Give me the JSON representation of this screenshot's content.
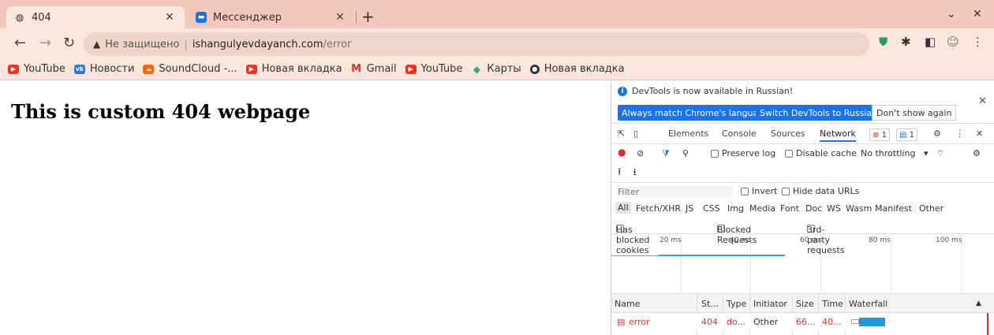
{
  "browser": {
    "tabs": [
      {
        "title": "404",
        "icon": "globe-icon",
        "active": true
      },
      {
        "title": "Мессенджер",
        "icon": "chat-icon",
        "active": false
      }
    ],
    "address": {
      "insecure_label": "Не защищено",
      "host": "ishangulyevdayanch.com",
      "path": "/error"
    },
    "bookmarks": [
      {
        "label": "YouTube",
        "icon": "youtube-icon"
      },
      {
        "label": "Новости",
        "icon": "vk-icon"
      },
      {
        "label": "SoundCloud -...",
        "icon": "soundcloud-icon"
      },
      {
        "label": "Новая вкладка",
        "icon": "youtube-icon"
      },
      {
        "label": "Gmail",
        "icon": "gmail-icon"
      },
      {
        "label": "YouTube",
        "icon": "youtube-icon"
      },
      {
        "label": "Карты",
        "icon": "maps-icon"
      },
      {
        "label": "Новая вкладка",
        "icon": "github-icon"
      }
    ]
  },
  "page": {
    "heading": "This is custom 404 webpage"
  },
  "devtools": {
    "info_message": "DevTools is now available in Russian!",
    "btn_match": "Always match Chrome's language",
    "btn_switch": "Switch DevTools to Russian",
    "btn_dismiss": "Don't show again",
    "tabs": [
      "Elements",
      "Console",
      "Sources",
      "Network"
    ],
    "error_count": "1",
    "message_count": "1",
    "network_toolbar": {
      "preserve_log": "Preserve log",
      "disable_cache": "Disable cache",
      "throttling": "No throttling"
    },
    "filter_placeholder": "Filter",
    "invert": "Invert",
    "hide_data_urls": "Hide data URLs",
    "types": [
      "All",
      "Fetch/XHR",
      "JS",
      "CSS",
      "Img",
      "Media",
      "Font",
      "Doc",
      "WS",
      "Wasm",
      "Manifest",
      "Other"
    ],
    "has_blocked_cookies": "Has blocked cookies",
    "blocked_requests": "Blocked Requests",
    "third_party": "3rd-party requests",
    "timeline_labels": [
      "20 ms",
      "40 ms",
      "60 ms",
      "80 ms",
      "100 ms"
    ],
    "columns": [
      "Name",
      "St...",
      "Type",
      "Initiator",
      "Size",
      "Time",
      "Waterfall"
    ],
    "rows": [
      {
        "name": "error",
        "status": "404",
        "type": "do...",
        "initiator": "Other",
        "size": "66...",
        "time": "40..."
      }
    ]
  },
  "colors": {
    "tabstrip": "#f3c9bb",
    "toolbar": "#fbe6de",
    "accent": "#1a73e8",
    "error": "#d93025"
  }
}
